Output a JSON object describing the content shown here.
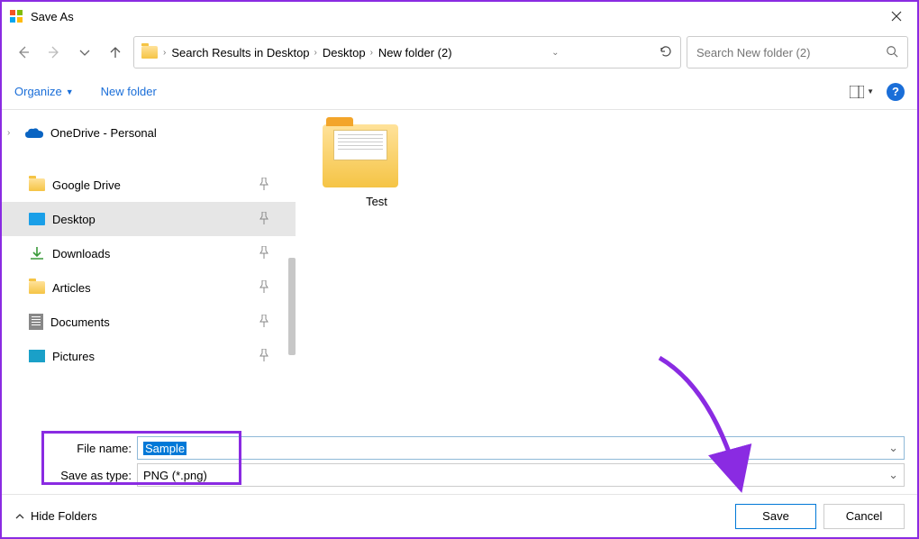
{
  "titlebar": {
    "title": "Save As"
  },
  "breadcrumb": {
    "items": [
      "Search Results in Desktop",
      "Desktop",
      "New folder (2)"
    ]
  },
  "search": {
    "placeholder": "Search New folder (2)"
  },
  "toolbar": {
    "organize": "Organize",
    "new_folder": "New folder"
  },
  "nav": {
    "onedrive": "OneDrive - Personal",
    "quick": [
      "Google Drive",
      "Desktop",
      "Downloads",
      "Articles",
      "Documents",
      "Pictures"
    ]
  },
  "content": {
    "items": [
      {
        "name": "Test"
      }
    ]
  },
  "fields": {
    "filename_label": "File name:",
    "filename_value": "Sample",
    "savetype_label": "Save as type:",
    "savetype_value": "PNG (*.png)"
  },
  "footer": {
    "hide_folders": "Hide Folders",
    "save": "Save",
    "cancel": "Cancel"
  }
}
